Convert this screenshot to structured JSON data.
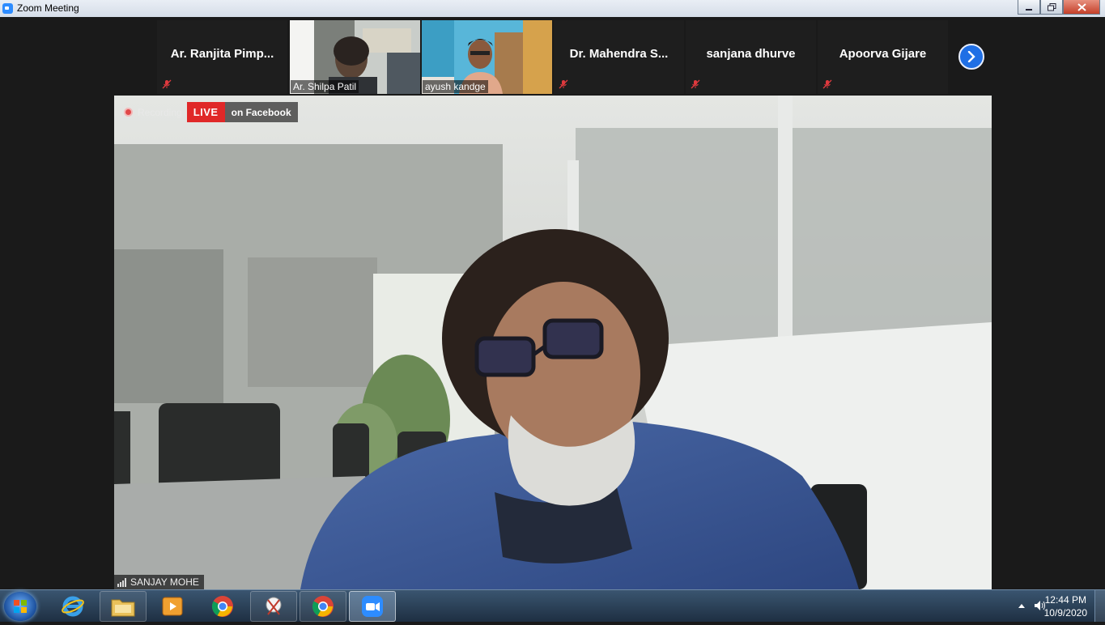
{
  "window": {
    "title": "Zoom Meeting"
  },
  "participants_strip": [
    {
      "name": "Ar. Ranjita Pimp...",
      "video": false,
      "muted": true
    },
    {
      "name": "Ar. Shilpa Patil",
      "video": true,
      "muted": false
    },
    {
      "name": "ayush kandge",
      "video": true,
      "muted": false
    },
    {
      "name": "Dr. Mahendra S...",
      "video": false,
      "muted": true
    },
    {
      "name": "sanjana dhurve",
      "video": false,
      "muted": true
    },
    {
      "name": "Apoorva Gijare",
      "video": false,
      "muted": true
    }
  ],
  "main_video": {
    "recording_label": "Recording",
    "live_label": "LIVE",
    "live_platform": "on Facebook",
    "speaker_name": "SANJAY MOHE"
  },
  "taskbar": {
    "time": "12:44 PM",
    "date": "10/9/2020"
  },
  "colors": {
    "zoom_blue": "#2d8cff",
    "live_red": "#e02828",
    "muted_red": "#e0393e"
  }
}
